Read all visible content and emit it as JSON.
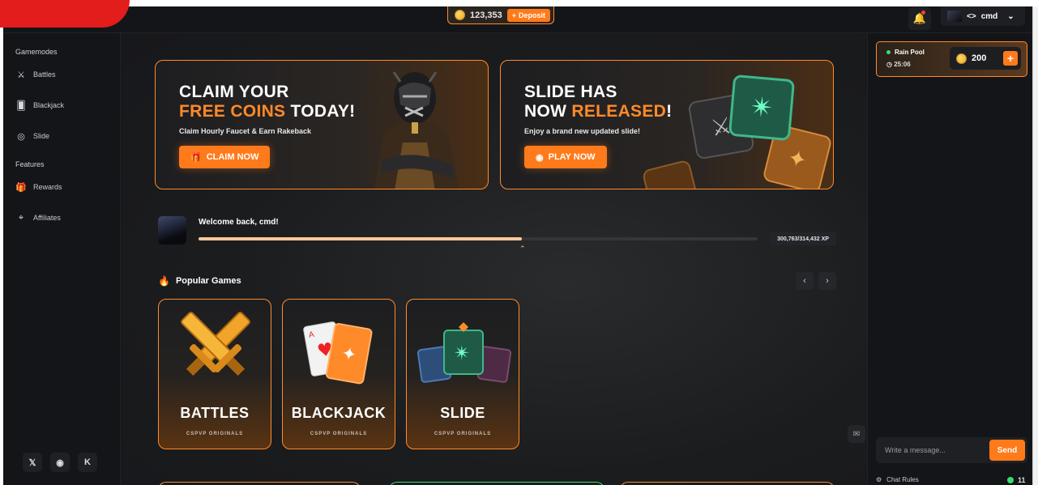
{
  "header": {
    "balance": "123,353",
    "deposit_label": "Deposit",
    "username": "cmd"
  },
  "sidebar": {
    "section_gamemodes": "Gamemodes",
    "section_features": "Features",
    "gamemodes": [
      {
        "label": "Battles",
        "icon": "swords-icon"
      },
      {
        "label": "Blackjack",
        "icon": "cards-icon"
      },
      {
        "label": "Slide",
        "icon": "target-icon"
      }
    ],
    "features": [
      {
        "label": "Rewards",
        "icon": "gift-icon"
      },
      {
        "label": "Affiliates",
        "icon": "crosshair-icon"
      }
    ],
    "socials": [
      "X",
      "Discord",
      "Kick"
    ]
  },
  "banners": [
    {
      "title_line1": "CLAIM YOUR",
      "title_line2_accent": "FREE COINS",
      "title_line2_rest": " TODAY!",
      "subtitle": "Claim Hourly Faucet & Earn Rakeback",
      "cta": "CLAIM NOW"
    },
    {
      "title_line1": "SLIDE HAS",
      "title_line2_pre": "NOW ",
      "title_line2_accent": "RELEASED",
      "title_line2_rest": "!",
      "subtitle": "Enjoy a brand new updated slide!",
      "cta": "PLAY NOW"
    }
  ],
  "welcome": {
    "message": "Welcome back, cmd!",
    "xp_label": "300,763/314,432 XP",
    "xp_fraction": 0.5788
  },
  "popular": {
    "title": "Popular Games",
    "games": [
      {
        "name": "BATTLES",
        "sub": "CSPVP ORIGINALS"
      },
      {
        "name": "BLACKJACK",
        "sub": "CSPVP ORIGINALS"
      },
      {
        "name": "SLIDE",
        "sub": "CSPVP ORIGINALS"
      }
    ]
  },
  "chat": {
    "rain_title": "Rain Pool",
    "rain_timer": "25:06",
    "rain_amount": "200",
    "input_placeholder": "Write a message...",
    "send_label": "Send",
    "rules_label": "Chat Rules",
    "online_count": "11"
  },
  "colors": {
    "accent": "#ff7a1a",
    "online": "#34e06b",
    "background": "#17181b"
  }
}
